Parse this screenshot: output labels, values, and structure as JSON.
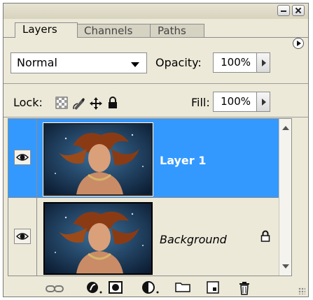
{
  "tabs": [
    {
      "label": "Layers",
      "active": true
    },
    {
      "label": "Channels",
      "active": false
    },
    {
      "label": "Paths",
      "active": false
    }
  ],
  "blend_mode": {
    "value": "Normal"
  },
  "opacity": {
    "label": "Opacity:",
    "value": "100%"
  },
  "lock": {
    "label": "Lock:"
  },
  "fill": {
    "label": "Fill:",
    "value": "100%"
  },
  "layers": [
    {
      "name": "Layer 1",
      "visible": true,
      "selected": true,
      "locked": false
    },
    {
      "name": "Background",
      "visible": true,
      "selected": false,
      "locked": true
    }
  ],
  "colors": {
    "selection": "#3399ff",
    "panel": "#ece9d8"
  },
  "bottom_icons": [
    "link-icon",
    "layer-style-icon",
    "layer-mask-icon",
    "adjustment-layer-icon",
    "new-group-icon",
    "new-layer-icon",
    "trash-icon"
  ]
}
